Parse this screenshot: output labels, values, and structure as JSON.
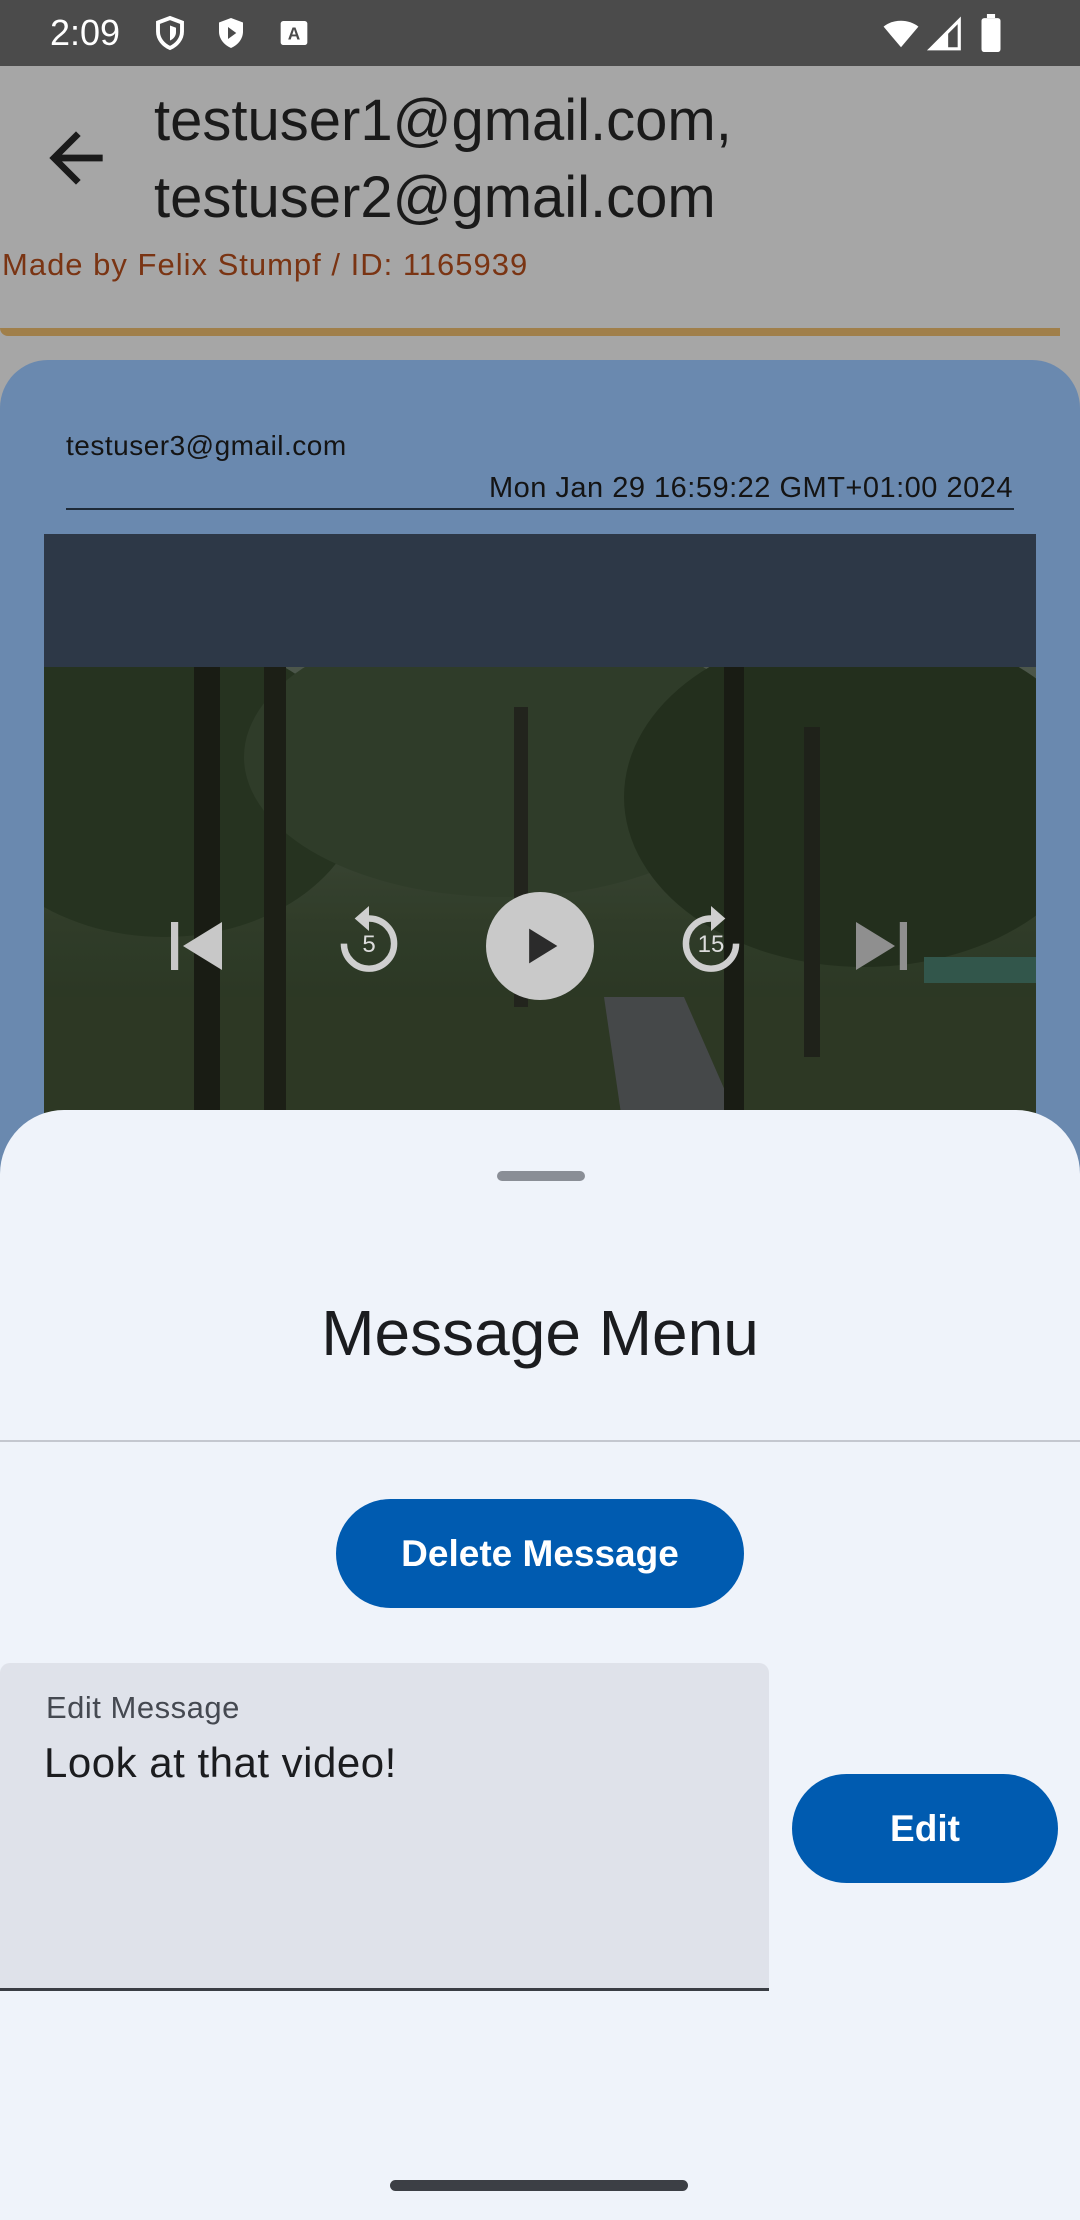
{
  "status_bar": {
    "time": "2:09",
    "left_icons": [
      "shield-icon",
      "play-protect-icon",
      "keyboard-a-icon"
    ],
    "right_icons": [
      "wifi-icon",
      "signal-icon",
      "battery-icon"
    ]
  },
  "app_bar": {
    "back_icon": "arrow-back-icon",
    "title_line1": "testuser1@gmail.com,",
    "title_line2": "testuser2@gmail.com",
    "subtitle": "Made by Felix Stumpf / ID: 1165939"
  },
  "message": {
    "sender": "testuser3@gmail.com",
    "timestamp": "Mon Jan 29 16:59:22 GMT+01:00 2024",
    "video_controls": [
      "skip-previous-icon",
      "replay-5-icon",
      "play-icon",
      "forward-15-icon",
      "skip-next-icon"
    ],
    "replay_seconds": "5",
    "forward_seconds": "15"
  },
  "sheet": {
    "title": "Message Menu",
    "delete_label": "Delete Message",
    "edit_field_label": "Edit Message",
    "edit_field_value": "Look at that video!",
    "edit_button_label": "Edit"
  },
  "colors": {
    "primary": "#005bb0",
    "sheet_bg": "#eff3fa",
    "accent_gold": "#a07f4a",
    "subtitle_text": "#7a3413"
  }
}
